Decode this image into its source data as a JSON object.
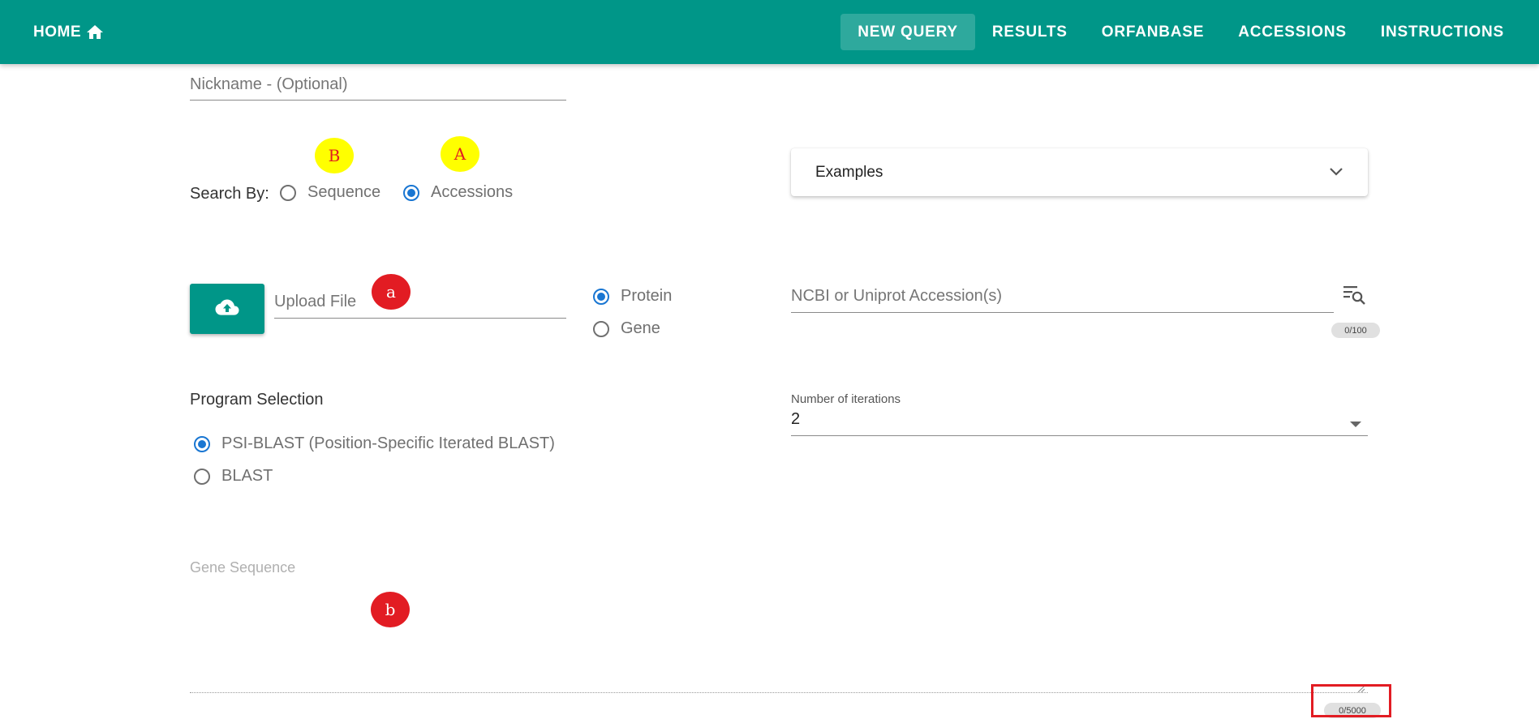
{
  "nav": {
    "home_label": "HOME",
    "items": [
      {
        "label": "NEW QUERY",
        "active": true
      },
      {
        "label": "RESULTS"
      },
      {
        "label": "ORFANBASE"
      },
      {
        "label": "ACCESSIONS"
      },
      {
        "label": "INSTRUCTIONS"
      }
    ]
  },
  "form": {
    "nickname_placeholder": "Nickname - (Optional)",
    "search_by_label": "Search By:",
    "search_by_options": [
      {
        "label": "Sequence",
        "checked": false
      },
      {
        "label": "Accessions",
        "checked": true
      }
    ],
    "examples_label": "Examples",
    "upload_placeholder": "Upload File",
    "type_options": [
      {
        "label": "Protein",
        "checked": true
      },
      {
        "label": "Gene",
        "checked": false
      }
    ],
    "accession_placeholder": "NCBI or Uniprot Accession(s)",
    "accession_counter": "0/100",
    "program_label": "Program Selection",
    "program_options": [
      {
        "label": "PSI-BLAST (Position-Specific Iterated BLAST)",
        "checked": true
      },
      {
        "label": "BLAST",
        "checked": false
      }
    ],
    "iterations_label": "Number of iterations",
    "iterations_value": "2",
    "gene_sequence_placeholder": "Gene Sequence",
    "gene_sequence_counter": "0/5000"
  },
  "annotations": {
    "B": "B",
    "A": "A",
    "a": "a",
    "b": "b"
  },
  "colors": {
    "primary": "#009688",
    "radio_checked": "#1976d2",
    "marker_yellow": "#ffff00",
    "marker_red": "#e21c23"
  }
}
